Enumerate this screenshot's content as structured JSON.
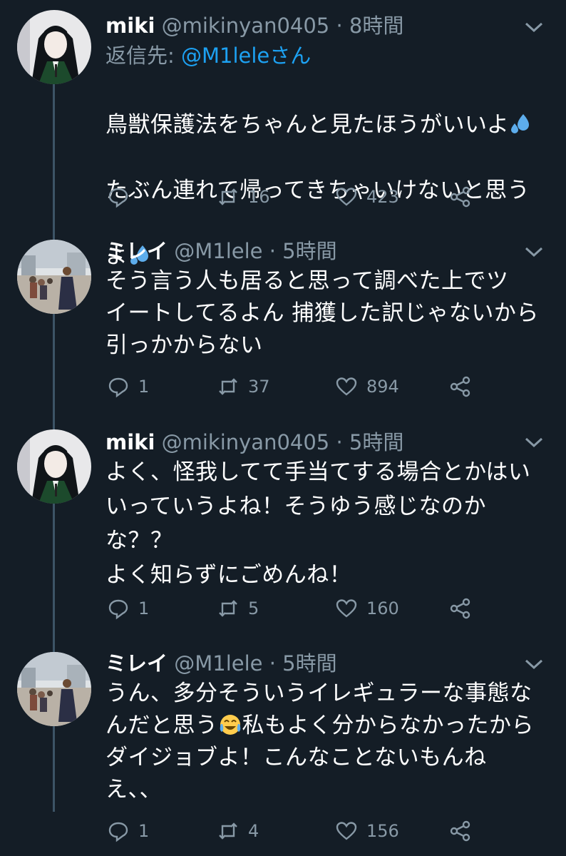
{
  "tweets": [
    {
      "name": "miki",
      "handle": "@mikinyan0405",
      "time": "8時間",
      "reply_prefix": "返信先: ",
      "reply_to": "@M1leleさん",
      "text_lines": [
        "鳥獣保護法をちゃんと見たほうがいいよ",
        "たぶん連れて帰ってきちゃいけないと思う",
        "よ"
      ],
      "counts": {
        "reply": "",
        "retweet": "16",
        "like": "423"
      }
    },
    {
      "name": "ミレイ",
      "handle": "@M1lele",
      "time": "5時間",
      "text": "そう言う人も居ると思って調べた上でツ\nイートしてるよん 捕獲した訳じゃないから\n引っかからない",
      "counts": {
        "reply": "1",
        "retweet": "37",
        "like": "894"
      }
    },
    {
      "name": "miki",
      "handle": "@mikinyan0405",
      "time": "5時間",
      "text": "よく、怪我してて手当てする場合とかはい\nいっていうよね！そうゆう感じなのか\nな？？\nよく知らずにごめんね！",
      "counts": {
        "reply": "1",
        "retweet": "5",
        "like": "160"
      }
    },
    {
      "name": "ミレイ",
      "handle": "@M1lele",
      "time": "5時間",
      "text_a": "うん、多分そういうイレギュラーな事態な\nんだと思う",
      "text_b": "私もよく分からなかったから\nダイジョブよ！こんなことないもんね\nえ、、",
      "counts": {
        "reply": "1",
        "retweet": "4",
        "like": "156"
      }
    }
  ],
  "separator": " · ",
  "colors": {
    "background": "#141d26",
    "secondary": "#8899a6",
    "link": "#1da1f2",
    "thread": "#3d5466"
  },
  "icons": [
    "reply-icon",
    "retweet-icon",
    "like-icon",
    "share-icon",
    "chevron-down-icon",
    "sweat-droplets-emoji",
    "tears-of-joy-emoji"
  ]
}
